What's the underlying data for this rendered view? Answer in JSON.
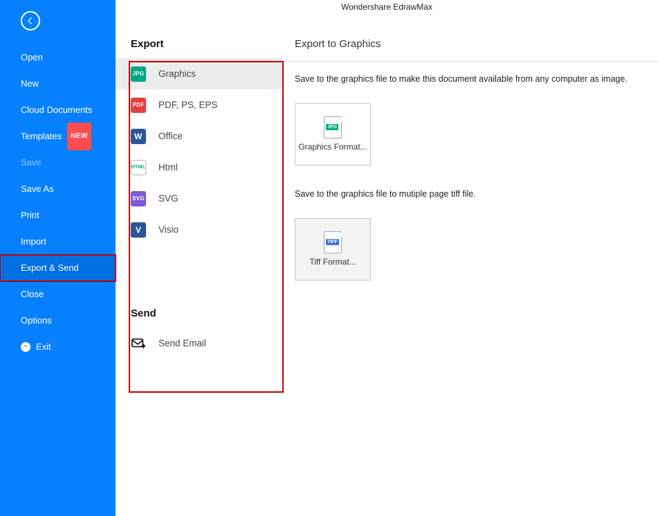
{
  "title": "Wondershare EdrawMax",
  "sidebar": {
    "items": [
      {
        "label": "Open"
      },
      {
        "label": "New"
      },
      {
        "label": "Cloud Documents"
      },
      {
        "label": "Templates",
        "badge": "NEW"
      },
      {
        "label": "Save"
      },
      {
        "label": "Save As"
      },
      {
        "label": "Print"
      },
      {
        "label": "Import"
      },
      {
        "label": "Export & Send"
      },
      {
        "label": "Close"
      },
      {
        "label": "Options"
      },
      {
        "label": "Exit"
      }
    ]
  },
  "mid": {
    "export_title": "Export",
    "send_title": "Send",
    "export_items": [
      {
        "label": "Graphics",
        "icon": "JPG",
        "cls": "jpg"
      },
      {
        "label": "PDF, PS, EPS",
        "icon": "PDF",
        "cls": "pdf"
      },
      {
        "label": "Office",
        "icon": "W",
        "cls": "word"
      },
      {
        "label": "Html",
        "icon": "HTML",
        "cls": "html-i"
      },
      {
        "label": "SVG",
        "icon": "SVG",
        "cls": "svg-i"
      },
      {
        "label": "Visio",
        "icon": "V",
        "cls": "visio"
      }
    ],
    "send_items": [
      {
        "label": "Send Email"
      }
    ]
  },
  "right": {
    "title": "Export to Graphics",
    "desc1": "Save to the graphics file to make this document available from any computer as image.",
    "graphics_caption": "Graphics Format...",
    "desc2": "Save to the graphics file to mutiple page tiff file.",
    "tiff_caption": "Tiff Format..."
  }
}
